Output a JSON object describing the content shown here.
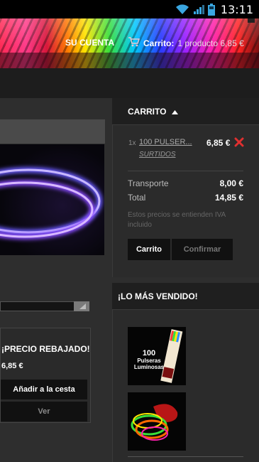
{
  "status_bar": {
    "time": "13:11",
    "icons": [
      "wifi-icon",
      "signal-icon",
      "battery-icon"
    ]
  },
  "header": {
    "account_label": "SU CUENTA",
    "cart_label": "Carrito:",
    "cart_summary": "1 producto 6,85 €"
  },
  "product": {
    "sale_label": "¡PRECIO REBAJADO!",
    "price": "6,85 €",
    "add_to_cart_label": "Añadir a la cesta",
    "view_label": "Ver"
  },
  "cart": {
    "title": "CARRITO",
    "item": {
      "quantity": "1x",
      "name": "100 PULSER...",
      "attribute": "SURTIDOS",
      "price": "6,85 €"
    },
    "shipping_label": "Transporte",
    "shipping_value": "8,00 €",
    "total_label": "Total",
    "total_value": "14,85 €",
    "tax_note": "Estos precios se entienden IVA incluido",
    "cart_button": "Carrito",
    "confirm_button": "Confirmar"
  },
  "best_sellers": {
    "title": "¡LO MÁS VENDIDO!",
    "thumb1_text": "100",
    "thumb1_line2": "Pulseras",
    "thumb1_line3": "Luminosas"
  },
  "colors": {
    "remove_red": "#e03030",
    "panel_dark": "#1f1f1f",
    "panel": "#2b2b2b"
  }
}
